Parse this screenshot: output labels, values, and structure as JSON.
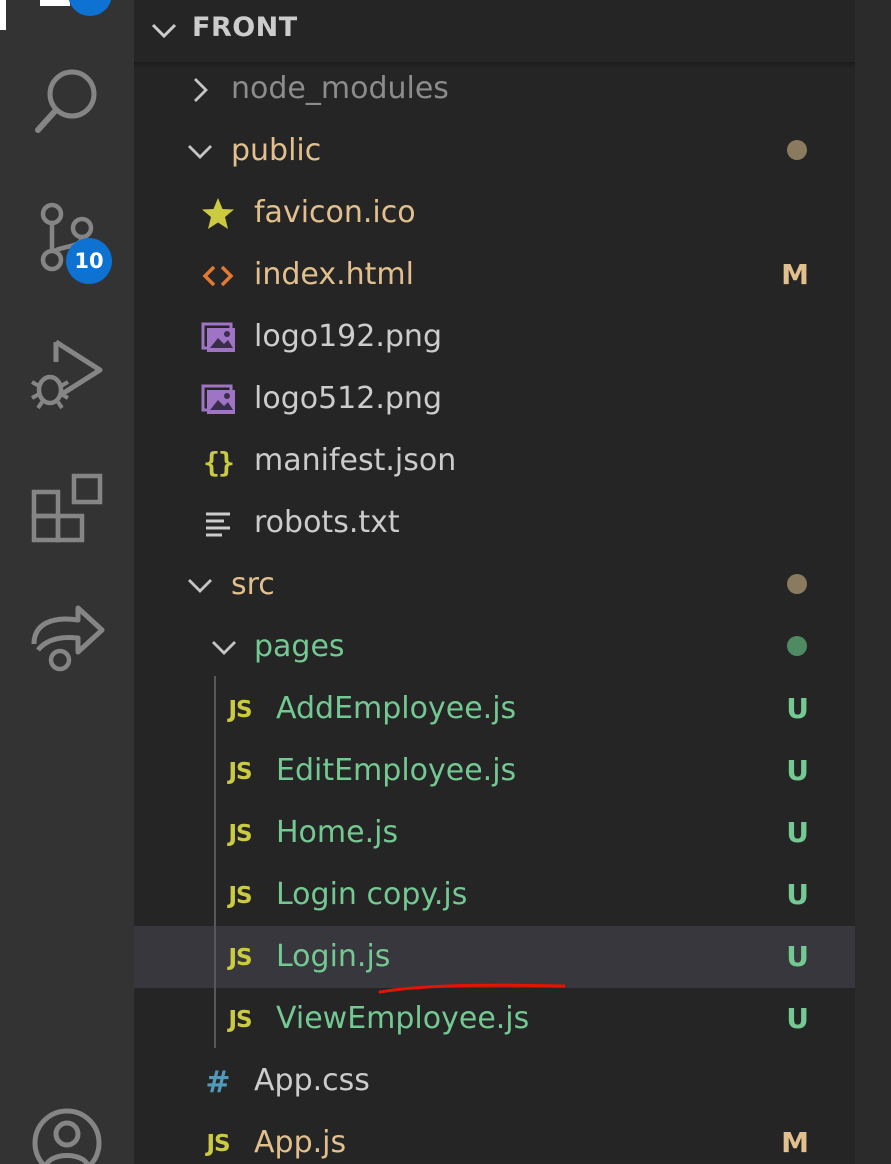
{
  "colors": {
    "activity_bar": "#333333",
    "sidebar": "#252526",
    "selected_row": "#37373d",
    "badge": "#0e72d2",
    "ignored": "#8c8c8c",
    "modified": "#e2c08d",
    "untracked": "#73c991",
    "annotation": "#e51400"
  },
  "activity_bar": {
    "items": [
      {
        "icon": "explorer-icon"
      },
      {
        "icon": "search-icon"
      },
      {
        "icon": "source-control-icon",
        "badge": "10"
      },
      {
        "icon": "run-debug-icon"
      },
      {
        "icon": "extensions-icon"
      },
      {
        "icon": "live-share-icon"
      },
      {
        "icon": "account-icon"
      }
    ]
  },
  "explorer": {
    "section_title": "FRONT",
    "tree": [
      {
        "name": "node_modules",
        "type": "folder",
        "expanded": false,
        "depth": 0,
        "color": "#8c8c8c"
      },
      {
        "name": "public",
        "type": "folder",
        "expanded": true,
        "depth": 0,
        "color": "#e2c08d",
        "decoration": "dot"
      },
      {
        "name": "favicon.ico",
        "type": "file",
        "icon": "star-icon",
        "depth": 1,
        "color": "#e2c08d"
      },
      {
        "name": "index.html",
        "type": "file",
        "icon": "html-icon",
        "depth": 1,
        "color": "#e2c08d",
        "status": "M"
      },
      {
        "name": "logo192.png",
        "type": "file",
        "icon": "image-icon",
        "depth": 1,
        "color": "#cccccc"
      },
      {
        "name": "logo512.png",
        "type": "file",
        "icon": "image-icon",
        "depth": 1,
        "color": "#cccccc"
      },
      {
        "name": "manifest.json",
        "type": "file",
        "icon": "json-icon",
        "depth": 1,
        "color": "#cccccc"
      },
      {
        "name": "robots.txt",
        "type": "file",
        "icon": "text-file-icon",
        "depth": 1,
        "color": "#cccccc"
      },
      {
        "name": "src",
        "type": "folder",
        "expanded": true,
        "depth": 0,
        "color": "#e2c08d",
        "decoration": "dot"
      },
      {
        "name": "pages",
        "type": "folder",
        "expanded": true,
        "depth": 1,
        "color": "#73c991",
        "decoration": "dot"
      },
      {
        "name": "AddEmployee.js",
        "type": "file",
        "icon": "js-icon",
        "depth": 2,
        "color": "#73c991",
        "status": "U"
      },
      {
        "name": "EditEmployee.js",
        "type": "file",
        "icon": "js-icon",
        "depth": 2,
        "color": "#73c991",
        "status": "U"
      },
      {
        "name": "Home.js",
        "type": "file",
        "icon": "js-icon",
        "depth": 2,
        "color": "#73c991",
        "status": "U"
      },
      {
        "name": "Login copy.js",
        "type": "file",
        "icon": "js-icon",
        "depth": 2,
        "color": "#73c991",
        "status": "U"
      },
      {
        "name": "Login.js",
        "type": "file",
        "icon": "js-icon",
        "depth": 2,
        "color": "#73c991",
        "status": "U",
        "selected": true
      },
      {
        "name": "ViewEmployee.js",
        "type": "file",
        "icon": "js-icon",
        "depth": 2,
        "color": "#73c991",
        "status": "U"
      },
      {
        "name": "App.css",
        "type": "file",
        "icon": "css-icon",
        "depth": 1,
        "color": "#cccccc"
      },
      {
        "name": "App.js",
        "type": "file",
        "icon": "js-icon",
        "depth": 1,
        "color": "#e2c08d",
        "status": "M"
      }
    ]
  }
}
